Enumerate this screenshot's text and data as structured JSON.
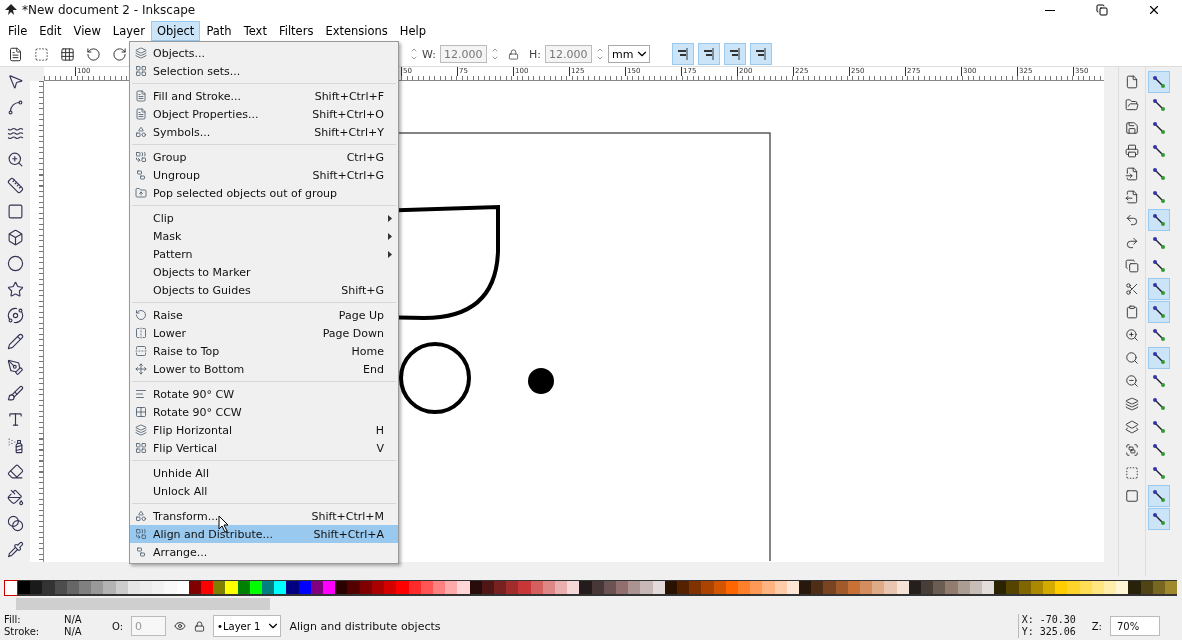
{
  "window": {
    "title": "*New document 2 - Inkscape"
  },
  "menu_bar": [
    {
      "label": "File",
      "selected": false
    },
    {
      "label": "Edit",
      "selected": false
    },
    {
      "label": "View",
      "selected": false
    },
    {
      "label": "Layer",
      "selected": false
    },
    {
      "label": "Object",
      "selected": true
    },
    {
      "label": "Path",
      "selected": false
    },
    {
      "label": "Text",
      "selected": false
    },
    {
      "label": "Filters",
      "selected": false
    },
    {
      "label": "Extensions",
      "selected": false
    },
    {
      "label": "Help",
      "selected": false
    }
  ],
  "toolbar": {
    "w_label": "W:",
    "w_value": "12.000",
    "h_label": "H:",
    "h_value": "12.000",
    "unit": "mm",
    "align_buttons": [
      {
        "on": true
      },
      {
        "on": true
      },
      {
        "on": true
      },
      {
        "on": true
      }
    ]
  },
  "top_ruler": {
    "left_labels": [
      "100"
    ],
    "labels": [
      "50",
      "75",
      "100",
      "125",
      "150",
      "175",
      "200",
      "225",
      "250",
      "275",
      "300",
      "325",
      "350"
    ]
  },
  "object_menu": {
    "sections": [
      [
        {
          "kind": "command",
          "label": "Objects...",
          "submenu": false,
          "selected": false
        },
        {
          "kind": "command",
          "label": "Selection sets...",
          "submenu": false,
          "selected": false
        }
      ],
      [
        {
          "kind": "command",
          "label": "Fill and Stroke...",
          "shortcut": "Shift+Ctrl+F",
          "submenu": false,
          "selected": false
        },
        {
          "kind": "command",
          "label": "Object Properties...",
          "shortcut": "Shift+Ctrl+O",
          "submenu": false,
          "selected": false
        },
        {
          "kind": "command",
          "label": "Symbols...",
          "shortcut": "Shift+Ctrl+Y",
          "submenu": false,
          "selected": false
        }
      ],
      [
        {
          "kind": "command",
          "label": "Group",
          "shortcut": "Ctrl+G",
          "submenu": false,
          "selected": false
        },
        {
          "kind": "command",
          "label": "Ungroup",
          "shortcut": "Shift+Ctrl+G",
          "submenu": false,
          "selected": false
        },
        {
          "kind": "command",
          "label": "Pop selected objects out of group",
          "submenu": false,
          "selected": false
        }
      ],
      [
        {
          "kind": "plain",
          "label": "Clip",
          "submenu": true,
          "selected": false
        },
        {
          "kind": "plain",
          "label": "Mask",
          "submenu": true,
          "selected": false
        },
        {
          "kind": "plain",
          "label": "Pattern",
          "submenu": true,
          "selected": false
        },
        {
          "kind": "plain",
          "label": "Objects to Marker",
          "submenu": false,
          "selected": false
        },
        {
          "kind": "plain",
          "label": "Objects to Guides",
          "shortcut": "Shift+G",
          "submenu": false,
          "selected": false
        }
      ],
      [
        {
          "kind": "command",
          "label": "Raise",
          "shortcut": "Page Up",
          "submenu": false,
          "selected": false
        },
        {
          "kind": "command",
          "label": "Lower",
          "shortcut": "Page Down",
          "submenu": false,
          "selected": false
        },
        {
          "kind": "command",
          "label": "Raise to Top",
          "shortcut": "Home",
          "submenu": false,
          "selected": false
        },
        {
          "kind": "command",
          "label": "Lower to Bottom",
          "shortcut": "End",
          "submenu": false,
          "selected": false
        }
      ],
      [
        {
          "kind": "command",
          "label": "Rotate 90° CW",
          "submenu": false,
          "selected": false
        },
        {
          "kind": "command",
          "label": "Rotate 90° CCW",
          "submenu": false,
          "selected": false
        },
        {
          "kind": "command",
          "label": "Flip Horizontal",
          "shortcut": "H",
          "submenu": false,
          "selected": false
        },
        {
          "kind": "command",
          "label": "Flip Vertical",
          "shortcut": "V",
          "submenu": false,
          "selected": false
        }
      ],
      [
        {
          "kind": "plain",
          "label": "Unhide All",
          "submenu": false,
          "selected": false
        },
        {
          "kind": "plain",
          "label": "Unlock All",
          "submenu": false,
          "selected": false
        }
      ],
      [
        {
          "kind": "command",
          "label": "Transform...",
          "shortcut": "Shift+Ctrl+M",
          "submenu": false,
          "selected": false
        },
        {
          "kind": "command",
          "label": "Align and Distribute...",
          "shortcut": "Shift+Ctrl+A",
          "submenu": false,
          "selected": true
        },
        {
          "kind": "command",
          "label": "Arrange...",
          "submenu": false,
          "selected": false
        }
      ]
    ]
  },
  "snap_bar": [
    {
      "on": true
    },
    {
      "on": false
    },
    {
      "on": false
    },
    {
      "on": false
    },
    {
      "on": false
    },
    {
      "on": false
    },
    {
      "on": true
    },
    {
      "on": false
    },
    {
      "on": false
    },
    {
      "on": true
    },
    {
      "on": true
    },
    {
      "on": false
    },
    {
      "on": true
    },
    {
      "on": false
    },
    {
      "on": false
    },
    {
      "on": false
    },
    {
      "on": false
    },
    {
      "on": false
    },
    {
      "on": true
    },
    {
      "on": true
    }
  ],
  "palette": [
    {
      "color": "#000000"
    },
    {
      "color": "#1a1a1a"
    },
    {
      "color": "#333333"
    },
    {
      "color": "#4d4d4d"
    },
    {
      "color": "#666666"
    },
    {
      "color": "#808080"
    },
    {
      "color": "#999999"
    },
    {
      "color": "#b3b3b3"
    },
    {
      "color": "#cccccc"
    },
    {
      "color": "#e6e6e6"
    },
    {
      "color": "#ececec"
    },
    {
      "color": "#f2f2f2"
    },
    {
      "color": "#f9f9f9"
    },
    {
      "color": "#ffffff"
    },
    {
      "color": "#800000"
    },
    {
      "color": "#ff0000"
    },
    {
      "color": "#808000"
    },
    {
      "color": "#ffff00"
    },
    {
      "color": "#008000"
    },
    {
      "color": "#00ff00"
    },
    {
      "color": "#008080"
    },
    {
      "color": "#00ffff"
    },
    {
      "color": "#000080"
    },
    {
      "color": "#0000ff"
    },
    {
      "color": "#800080"
    },
    {
      "color": "#ff00ff"
    },
    {
      "color": "#2b0000"
    },
    {
      "color": "#550000"
    },
    {
      "color": "#800001"
    },
    {
      "color": "#aa0000"
    },
    {
      "color": "#d40000"
    },
    {
      "color": "#ff0001"
    },
    {
      "color": "#ff2a2a"
    },
    {
      "color": "#ff5555"
    },
    {
      "color": "#ff8080"
    },
    {
      "color": "#ffaaaa"
    },
    {
      "color": "#ffd5d5"
    },
    {
      "color": "#280b0b"
    },
    {
      "color": "#501616"
    },
    {
      "color": "#782121"
    },
    {
      "color": "#a02c2c"
    },
    {
      "color": "#c83737"
    },
    {
      "color": "#d35f5f"
    },
    {
      "color": "#de8787"
    },
    {
      "color": "#e9afaf"
    },
    {
      "color": "#f4d7d7"
    },
    {
      "color": "#241c1c"
    },
    {
      "color": "#483737"
    },
    {
      "color": "#6c5353"
    },
    {
      "color": "#916f6f"
    },
    {
      "color": "#ac9393"
    },
    {
      "color": "#c8b7b7"
    },
    {
      "color": "#e3dbdb"
    },
    {
      "color": "#2b1100"
    },
    {
      "color": "#552200"
    },
    {
      "color": "#803300"
    },
    {
      "color": "#aa4400"
    },
    {
      "color": "#d45500"
    },
    {
      "color": "#ff6600"
    },
    {
      "color": "#ff7f2a"
    },
    {
      "color": "#ff9955"
    },
    {
      "color": "#ffb380"
    },
    {
      "color": "#ffccaa"
    },
    {
      "color": "#ffe6d5"
    },
    {
      "color": "#28170b"
    },
    {
      "color": "#502d16"
    },
    {
      "color": "#784421"
    },
    {
      "color": "#a05a2c"
    },
    {
      "color": "#c87137"
    },
    {
      "color": "#d38d5f"
    },
    {
      "color": "#deaa87"
    },
    {
      "color": "#e9c6af"
    },
    {
      "color": "#f4e3d7"
    },
    {
      "color": "#241f1c"
    },
    {
      "color": "#483e37"
    },
    {
      "color": "#6c5d53"
    },
    {
      "color": "#917c6f"
    },
    {
      "color": "#ac9d93"
    },
    {
      "color": "#c8beb7"
    },
    {
      "color": "#e3dedb"
    },
    {
      "color": "#2b2200"
    },
    {
      "color": "#554400"
    },
    {
      "color": "#806600"
    },
    {
      "color": "#aa8800"
    },
    {
      "color": "#d4aa00"
    },
    {
      "color": "#ffcc00"
    },
    {
      "color": "#ffd42a"
    },
    {
      "color": "#ffdd55"
    },
    {
      "color": "#ffe680"
    },
    {
      "color": "#ffeeaa"
    },
    {
      "color": "#fff6d5"
    },
    {
      "color": "#28220b"
    },
    {
      "color": "#504416"
    },
    {
      "color": "#786721"
    },
    {
      "color": "#a0892c"
    }
  ],
  "status_bar": {
    "fill_label": "Fill:",
    "fill_value": "N/A",
    "stroke_label": "Stroke:",
    "stroke_value": "N/A",
    "opacity_label": "O:",
    "opacity_value": "0",
    "layer": "•Layer 1",
    "message": "Align and distribute objects",
    "x_label": "X:",
    "x_value": "-70.30",
    "y_label": "Y:",
    "y_value": "325.06",
    "zoom_label": "Z:",
    "zoom_value": "70%"
  }
}
